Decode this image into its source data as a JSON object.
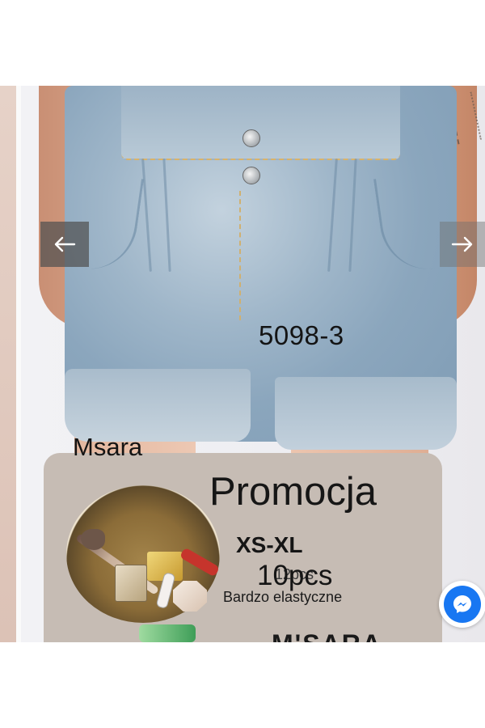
{
  "product": {
    "code": "5098-3",
    "brand": "Msara"
  },
  "promo": {
    "title": "Promocja",
    "size_range": "XS-XL",
    "pcs_small": "12pcs",
    "pcs_big": "10pcs",
    "description": "Bardzo elastyczne",
    "bottom_text": "M'SARA"
  },
  "icons": {
    "prev": "arrow-left-icon",
    "next": "arrow-right-icon",
    "chat": "messenger-icon"
  },
  "colors": {
    "messenger": "#1877f2",
    "promo_bg": "#c6bcb4"
  }
}
